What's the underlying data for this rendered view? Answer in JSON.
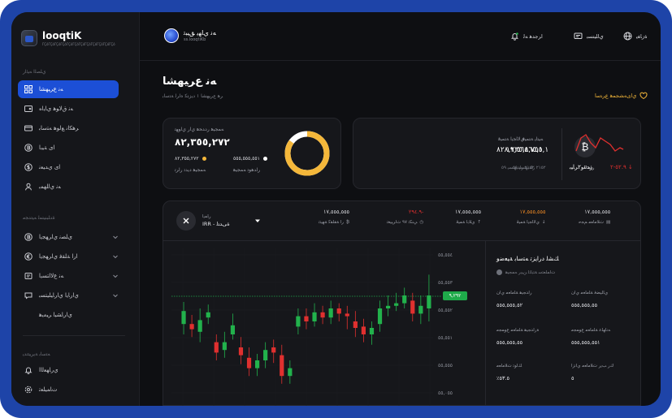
{
  "brand": {
    "app_name": "looqtiK",
    "app_tagline": "ΓÇóΓÇóΓÇóΓÇóΓÇóΓÇóΓÇóΓÇóΓÇóΓÇóΓÇóΓÇó",
    "site_name": "ﻪﻧ ﻱﺎﻬﻳ ﻖﻴﺒﺗ",
    "site_url": "ss.looqtiKb"
  },
  "sidebar": {
    "section_main": "ﻱﻠﺼﻟﺍ ﻪﻴﺋﺍﺭ",
    "items": [
      {
        "label": "ﻪﻧ ﻉﺮﻴﻬﺸﺎ",
        "icon": "grid-icon",
        "active": true
      },
      {
        "label": "ﻪﻧ ﻕﻻﻮﻫ ﻱﺎﻳﺍﻩ",
        "icon": "wallet-icon",
        "active": false
      },
      {
        "label": "ﺮﻫﻜﺍﻧ ﻊﻟﻮﻫ ﻪﺘﺳﺎﺑ",
        "icon": "card-icon",
        "active": false
      },
      {
        "label": "ﺍﻯ ﺔﻴﺑﺍ",
        "icon": "bitcoin-icon",
        "active": false
      },
      {
        "label": "ﺍﻯ ﻱﺪﻴﻌﻧ",
        "icon": "dollar-icon",
        "active": false
      },
      {
        "label": "ﻪﻧ ﻱﺍﻠﻬﻤﺑ",
        "icon": "user-icon",
        "active": false
      }
    ],
    "section_services": "ﺓﺪﻠﺒﻨﻴﺘﻤﻟ ﻪﻴﺗﺪﺠﻣ",
    "services": [
      {
        "label": "ﻱﻠﺼﻧ ﻱﺍﺮﻬﺠﻳﺍ",
        "icon": "bitcoin-icon"
      },
      {
        "label": "ﺍﺭﺍ ﺔﻠﻘﻓ ﻱﺍﺮﻬﺠﻳﺍ",
        "icon": "euro-icon"
      },
      {
        "label": "ﻪﻧ ﻉﻻﺍﺘﺴﻳﺍ",
        "icon": "receipt-icon"
      },
      {
        "label": "ﻱﺍﺭﺎﻳﺍ ﻱﺍﺭﺎﻴﻠﻴﺘﺴﺑ",
        "icon": "chat-icon"
      },
      {
        "label": "ﻱﺍﺭﺎﺸﻴﺍ ﺮﻴﻣﻳﻫ",
        "icon": "none"
      }
    ],
    "section_account": "ﻪﺘﺳﺎﺑ ﺔﻳﺮﻴﺘﺗﺪﻳ",
    "account": [
      {
        "label": "ﻱﺭﺎﻬﻌﻟﺍﺍ",
        "icon": "bell-icon"
      },
      {
        "label": "ﺕﺎﻤﻴﻠﻌﺗ",
        "icon": "settings-icon"
      }
    ]
  },
  "topbar": {
    "links": [
      {
        "label": "ﺓﺯﺎﻐﻳ",
        "icon": "globe-icon"
      },
      {
        "label": "ﻱﺎﻠﻴﺘﺴﺑ",
        "icon": "message-icon"
      },
      {
        "label": "ﺍﺮﺟﺪﻫ ﻪﻟ",
        "icon": "bell-icon"
      }
    ]
  },
  "page": {
    "title": "ﻪﻧ ﻉﺮﻴﻬﺸﺎ",
    "subtitle": "ﺮﻫ ﻉﺮﻴﻬﺸﺎ ١ ﺩﻳﺰﺘﻜ ﻩﺍﺮﻟ ﺔﺘﺳﺎﺑ",
    "favorite_label": "ﻱﺍﻯﻪﺸﺠﻤﻫ ﻉﺮﺘﺳﺍ"
  },
  "balance_card": {
    "label": "ﻪﻤﺠﻴﻫ ﺭﺩﺪﺤﻫ ﻱﺍﺭ ﻱﺍﻮﻬﺗ",
    "total": "٨٢,٣٥٥,٢٧٢",
    "left_value": "٨٢,٣٥٥,٢٧٢",
    "left_label": "ﻪﻤﺠﻴﻫ ﺩﻳﺪﺗ ﺭﺍﺮﺗ",
    "left_color": "#f4b73a",
    "right_value": "٥٥٥,٥٥٥,٥٥١",
    "right_label": "ﺭﺍﺪﻫﻮﺗ ﻪﻤﺠﻴﻫ",
    "right_color": "#ffffff",
    "donut_fraction": 0.85
  },
  "portfolio_card": {
    "coin_name": "ﺭﺪﺗﻧﻭ۲ﺮﺎﻴﺑ",
    "coin_symbol": "₿",
    "value_a_label": "ﻪﻴﺘﺍﻳ ﺔﺘﻤﻴﻗ",
    "value_a": "١٩٫٥٦٥,٧٥٥,١",
    "value_a_sub": "٢١٥٢ ﺭﺍﺪﻴﻬﺘﺴﻳ ٥٩",
    "value_b_label": "ﻱﻻﺎﺠﻳﺍ ﺔﺘﻤﻴﻗ",
    "value_b": "٨٢٨,٢٣٥,٨٦٥,١",
    "value_b_sub": "٢١٥٢ ﺭﺍﺪﻴﻬﺘﺴﻳ ٥٩",
    "change": "٥٢.٩-٢ ↓",
    "change_label": "ﺭﺎﻤﺘﻟﺍ",
    "change_color": "#e0302f"
  },
  "market_bar": {
    "pair_label": "ﺭﺎﻤﻳﺍ",
    "pair_value": "IRR - ﺓﻰﺪﺘﻟ",
    "stats": [
      {
        "value": "١٧,٥٥٥,٥٥٥",
        "label": "ﺭﺍ ﺔﻘﻠﻘﻛ ﺔﻬﻴﺘﺗ",
        "icon": "₿"
      },
      {
        "value": "٢٩٤.٩-",
        "label": "ﻲﻨﻜﺗ ٩٧ ﺕﺍﺮﻴﻴﻐﺗ",
        "icon": "◷"
      },
      {
        "value": "١٧,٥٥٥,٥٥٥",
        "label": "ﻱﻼﺑﺍ ﺔﻤﻴﻗ",
        "icon": "↑"
      },
      {
        "value": "١٧,٥٥٥,٥٥٥",
        "label": "ﻱﻻﺎﺠﻳﺍ ﺔﻤﻴﻗ",
        "icon": "↓"
      },
      {
        "value": "١٧,٥٥٥,٥٥٥",
        "label": "ﺕﻼﻣﺎﻌﻣ ﻢﺠﺣ",
        "icon": "▤"
      }
    ],
    "stat_colors": [
      "#c9cad0",
      "#e0302f",
      "#c9cad0",
      "#f08a24",
      "#c9cad0"
    ]
  },
  "chart_data": {
    "type": "candlestick",
    "y_ticks": [
      "٥٥,٥٥٤",
      "٥٥,٥٥٣",
      "٥٥,٥٥٢",
      "٥٥,٥٥١",
      "٥٥,٥٥٥",
      "٥٥,٠٥٥"
    ],
    "current_price": "٩,٢٩٢",
    "grid": true,
    "candles": [
      {
        "o": 42,
        "c": 52,
        "h": 35,
        "l": 60,
        "up": true
      },
      {
        "o": 52,
        "c": 56,
        "h": 45,
        "l": 62,
        "up": false
      },
      {
        "o": 58,
        "c": 49,
        "h": 40,
        "l": 66,
        "up": true
      },
      {
        "o": 47,
        "c": 43,
        "h": 37,
        "l": 52,
        "up": true
      },
      {
        "o": 66,
        "c": 74,
        "h": 60,
        "l": 80,
        "up": false
      },
      {
        "o": 72,
        "c": 66,
        "h": 58,
        "l": 78,
        "up": true
      },
      {
        "o": 60,
        "c": 53,
        "h": 44,
        "l": 64,
        "up": true
      },
      {
        "o": 70,
        "c": 76,
        "h": 62,
        "l": 83,
        "up": false
      },
      {
        "o": 78,
        "c": 86,
        "h": 70,
        "l": 92,
        "up": false
      },
      {
        "o": 86,
        "c": 80,
        "h": 75,
        "l": 92,
        "up": true
      },
      {
        "o": 80,
        "c": 72,
        "h": 66,
        "l": 86,
        "up": true
      },
      {
        "o": 74,
        "c": 70,
        "h": 64,
        "l": 82,
        "up": false
      },
      {
        "o": 76,
        "c": 92,
        "h": 68,
        "l": 98,
        "up": false
      },
      {
        "o": 92,
        "c": 86,
        "h": 80,
        "l": 98,
        "up": true
      },
      {
        "o": 54,
        "c": 46,
        "h": 40,
        "l": 60,
        "up": true
      },
      {
        "o": 46,
        "c": 50,
        "h": 40,
        "l": 56,
        "up": false
      },
      {
        "o": 50,
        "c": 43,
        "h": 36,
        "l": 54,
        "up": true
      },
      {
        "o": 43,
        "c": 47,
        "h": 38,
        "l": 52,
        "up": false
      },
      {
        "o": 47,
        "c": 40,
        "h": 34,
        "l": 52,
        "up": true
      },
      {
        "o": 40,
        "c": 44,
        "h": 36,
        "l": 50,
        "up": false
      },
      {
        "o": 44,
        "c": 46,
        "h": 38,
        "l": 56,
        "up": false
      },
      {
        "o": 50,
        "c": 55,
        "h": 42,
        "l": 62,
        "up": false
      },
      {
        "o": 54,
        "c": 60,
        "h": 48,
        "l": 66,
        "up": false
      },
      {
        "o": 60,
        "c": 55,
        "h": 50,
        "l": 68,
        "up": true
      },
      {
        "o": 52,
        "c": 40,
        "h": 34,
        "l": 58,
        "up": true
      },
      {
        "o": 40,
        "c": 38,
        "h": 30,
        "l": 46,
        "up": true
      },
      {
        "o": 38,
        "c": 36,
        "h": 28,
        "l": 42,
        "up": true
      },
      {
        "o": 36,
        "c": 30,
        "h": 24,
        "l": 40,
        "up": true
      },
      {
        "o": 34,
        "c": 44,
        "h": 28,
        "l": 50,
        "up": false
      },
      {
        "o": 44,
        "c": 38,
        "h": 30,
        "l": 52,
        "up": true
      },
      {
        "o": 40,
        "c": 30,
        "h": 14,
        "l": 50,
        "up": true
      }
    ]
  },
  "info_panel": {
    "title": "ﻚﺸﻟ ﺩﺭﺍﻳﺰﺗ ﻪﺘﺳﺎﺑ ﺔﻴﻌﺿﻭ",
    "subtitle": "ﺕﺎﻤﻠﻌﺘﺳ ﺔﺘﺑﺎﺜﻟ ﻦﻴﺑﺭ ﻪﻤﺠﻴﻫ",
    "rows": [
      {
        "left_label": "ﺭﺍﺪﺠﻴﻫ ﺔﻠﻣﺎﻌﻣ ﻱﺍﻥ",
        "left_value": "٥٥٥,٥٥٥,٥٢",
        "right_label": "ﻱﺎﻠﻴﻀﻓ ﺔﻠﻣﺎﻌﻣ ﻱﺍﻥ",
        "right_value": "٥٥٥,٥٥٥,٥٥"
      },
      {
        "left_label": "ﺓﺭﺍﺪﺠﻴﻫ ﺔﻠﻣﺎﻌﻣ ﻉﻮﻤﺠﻣ",
        "left_value": "٥٥٥,٥٥٥,٥٥",
        "right_label": "ﻪﻧﺎﻬﻠﻋ ﺔﻠﻣﺎﻌﻣ ﻉﻮﻤﺠﻣ",
        "right_value": "٥٥٥,٥٥٥,٥٥١"
      },
      {
        "left_label": "ﻚﻟﻮﺗ ﺕﻼﻣﺎﻌﻣ",
        "left_value": "٪٥٣.٥",
        "right_label": "ﻙﺭ ﺐﻳﺭ ﺕﻼﻣﺎﻌﻣ ﻱﺍﻧﺯﺍ",
        "right_value": "٥"
      }
    ]
  },
  "colors": {
    "accent": "#1c4fd6",
    "up": "#22b24c",
    "down": "#e0302f",
    "frame": "#1e44a8",
    "gold": "#f4b73a"
  }
}
